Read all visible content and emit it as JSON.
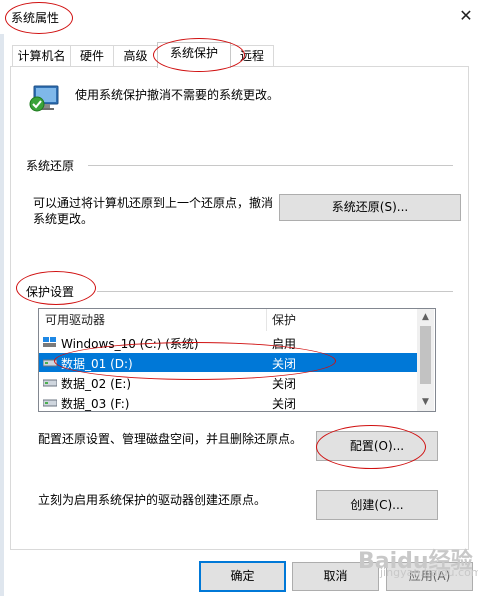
{
  "window": {
    "title": "系统属性",
    "close_glyph": "✕"
  },
  "tabs": [
    {
      "label": "计算机名"
    },
    {
      "label": "硬件"
    },
    {
      "label": "高级"
    },
    {
      "label": "系统保护"
    },
    {
      "label": "远程"
    }
  ],
  "active_tab": "系统保护",
  "intro": {
    "text": "使用系统保护撤消不需要的系统更改。",
    "icon": "system-protection-icon"
  },
  "restore": {
    "heading": "系统还原",
    "description_line1": "可以通过将计算机还原到上一个还原点，撤消",
    "description_line2": "系统更改。",
    "button": "系统还原(S)..."
  },
  "protection": {
    "heading": "保护设置",
    "columns": [
      "可用驱动器",
      "保护"
    ],
    "drives": [
      {
        "name": "Windows_10 (C:) (系统)",
        "status": "启用",
        "icon": "system-drive-icon",
        "selected": false
      },
      {
        "name": "数据_01 (D:)",
        "status": "关闭",
        "icon": "drive-icon",
        "selected": true
      },
      {
        "name": "数据_02 (E:)",
        "status": "关闭",
        "icon": "drive-icon",
        "selected": false
      },
      {
        "name": "数据_03 (F:)",
        "status": "关闭",
        "icon": "drive-icon",
        "selected": false
      }
    ],
    "configure_text": "配置还原设置、管理磁盘空间，并且删除还原点。",
    "configure_button": "配置(O)...",
    "create_text": "立刻为启用系统保护的驱动器创建还原点。",
    "create_button": "创建(C)..."
  },
  "footer": {
    "ok": "确定",
    "cancel": "取消",
    "apply": "应用(A)"
  },
  "watermark": {
    "brand": "Baidu经验",
    "url": "jingyan.baidu.com"
  },
  "colors": {
    "accent": "#0078d7",
    "annotation": "#d01010",
    "selected_row": "#0078d7"
  }
}
